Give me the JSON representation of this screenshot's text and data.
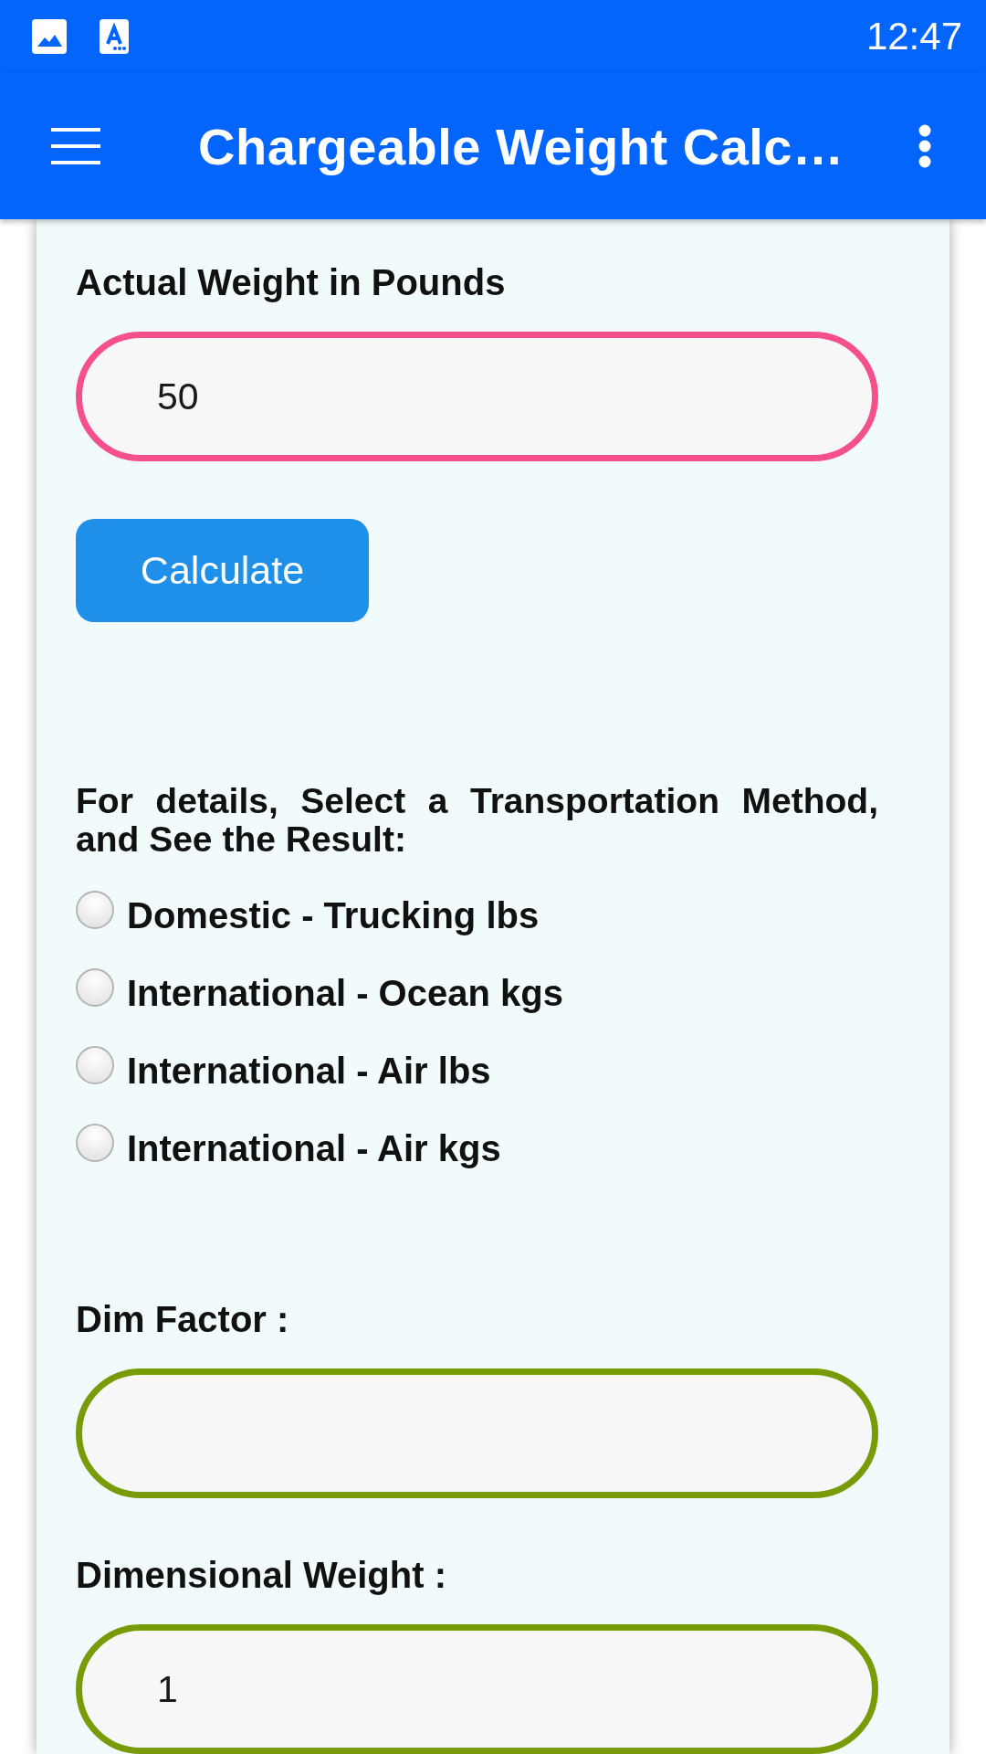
{
  "status_bar": {
    "time": "12:47"
  },
  "app_bar": {
    "title": "Chargeable Weight Calc…"
  },
  "form": {
    "weight": {
      "label": "Actual Weight in Pounds",
      "value": "50"
    },
    "calculate_button": {
      "label": "Calculate"
    },
    "method_prompt": "For details, Select a Transportation Method, and See the Result:",
    "methods": [
      {
        "label": "Domestic - Trucking lbs",
        "selected": false
      },
      {
        "label": "International - Ocean kgs",
        "selected": false
      },
      {
        "label": "International - Air lbs",
        "selected": false
      },
      {
        "label": "International - Air kgs",
        "selected": false
      }
    ],
    "dim_factor": {
      "label": "Dim Factor :"
    },
    "dimensional_weight": {
      "label": "Dimensional Weight :",
      "value": "1"
    }
  }
}
